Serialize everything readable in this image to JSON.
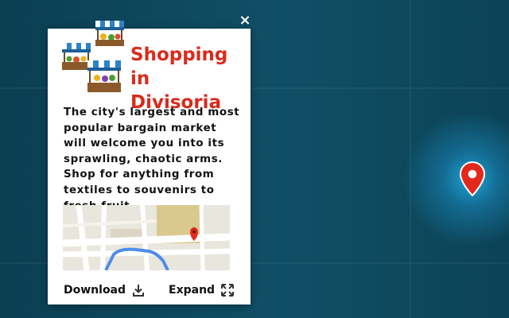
{
  "popup": {
    "title_line1": "Shopping",
    "title_line2": "in Divisoria",
    "description": "The city's largest and most popular bargain market will welcome you into its sprawling, chaotic arms. Shop for anything from textiles to souvenirs to fresh fruit.",
    "download_label": "Download",
    "expand_label": "Expand",
    "close_glyph": "×"
  },
  "icons": {
    "close": "close-icon",
    "download": "download-icon",
    "expand": "expand-icon",
    "pin": "map-pin-icon",
    "illustration": "market-stalls-illustration"
  },
  "colors": {
    "title": "#d92b1c",
    "pin": "#e3291c",
    "background": "#0d4558"
  }
}
